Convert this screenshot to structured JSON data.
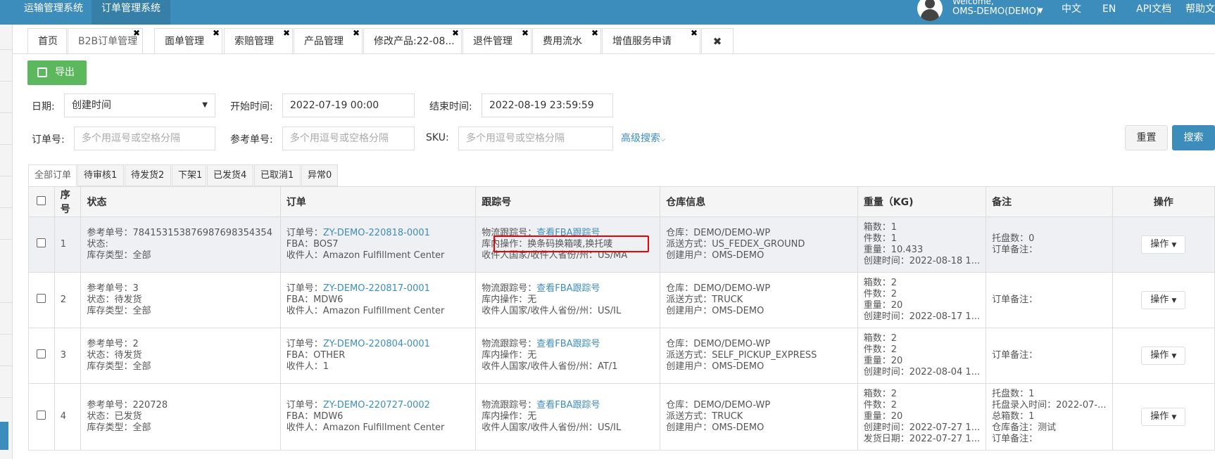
{
  "topbar": {
    "systems": [
      "运输管理系统",
      "订单管理系统"
    ],
    "welcome": "Welcome,",
    "user": "OMS-DEMO(DEMO)",
    "right_links": [
      "中文",
      "EN",
      "API文档",
      "帮助文"
    ]
  },
  "tabs": [
    {
      "label": "首页",
      "closable": false
    },
    {
      "label": "B2B订单管理",
      "closable": true,
      "active": true
    },
    {
      "label": "面单管理",
      "closable": true
    },
    {
      "label": "索赔管理",
      "closable": true
    },
    {
      "label": "产品管理",
      "closable": true
    },
    {
      "label": "修改产品:22-08...",
      "closable": true
    },
    {
      "label": "退件管理",
      "closable": true
    },
    {
      "label": "费用流水",
      "closable": true
    },
    {
      "label": "增值服务申请",
      "closable": true
    }
  ],
  "toolbar": {
    "export_label": "导出"
  },
  "filters": {
    "date_label": "日期:",
    "date_type": "创建时间",
    "start_label": "开始时间:",
    "start_value": "2022-07-19 00:00",
    "end_label": "结束时间:",
    "end_value": "2022-08-19 23:59:59",
    "order_label": "订单号:",
    "order_placeholder": "多个用逗号或空格分隔",
    "ref_label": "参考单号:",
    "ref_placeholder": "多个用逗号或空格分隔",
    "sku_label": "SKU:",
    "sku_placeholder": "多个用逗号或空格分隔",
    "advanced": "高级搜索",
    "reset": "重置",
    "search": "搜索"
  },
  "status_tabs": [
    "全部订单",
    "待审核1",
    "待发货2",
    "下架1",
    "已发货4",
    "已取消1",
    "异常0"
  ],
  "table": {
    "headers": [
      "序号",
      "状态",
      "订单",
      "跟踪号",
      "仓库信息",
      "重量（KG)",
      "备注",
      "操作"
    ],
    "rows": [
      {
        "no": "1",
        "status": [
          "参考单号：784153153876987698354354",
          "状态:",
          "库存类型：全部"
        ],
        "order_label": "订单号：",
        "order_link": "ZY-DEMO-220818-0001",
        "order_lines": [
          "FBA：BOS7",
          "收件人：Amazon Fulfillment Center"
        ],
        "track_label": "物流跟踪号：",
        "track_link": "查看FBA跟踪号",
        "track_lines": [
          "库内操作：换条码换箱唛,换托唛",
          "收件人国家/收件人省份/州：US/MA"
        ],
        "warehouse": [
          "仓库：DEMO/DEMO-WP",
          "派送方式：US_FEDEX_GROUND",
          "创建用户：OMS-DEMO"
        ],
        "weight": [
          "箱数：1",
          "件数：1",
          "重量：10.433",
          "创建时间：2022-08-18 1..."
        ],
        "remark": [
          "托盘数：0",
          "订单备注："
        ],
        "op": "操作"
      },
      {
        "no": "2",
        "status": [
          "参考单号：3",
          "状态：待发货",
          "库存类型：全部"
        ],
        "order_label": "订单号：",
        "order_link": "ZY-DEMO-220817-0001",
        "order_lines": [
          "FBA：MDW6",
          "收件人：Amazon Fulfillment Center"
        ],
        "track_label": "物流跟踪号：",
        "track_link": "查看FBA跟踪号",
        "track_lines": [
          "库内操作：无",
          "收件人国家/收件人省份/州：US/IL"
        ],
        "warehouse": [
          "仓库：DEMO/DEMO-WP",
          "派送方式：TRUCK",
          "创建用户：OMS-DEMO"
        ],
        "weight": [
          "箱数：2",
          "件数：2",
          "重量：20",
          "创建时间：2022-08-17 1..."
        ],
        "remark": [
          "订单备注："
        ],
        "op": "操作"
      },
      {
        "no": "3",
        "status": [
          "参考单号：2",
          "状态：待发货",
          "库存类型：全部"
        ],
        "order_label": "订单号：",
        "order_link": "ZY-DEMO-220804-0001",
        "order_lines": [
          "FBA：OTHER",
          "收件人：1"
        ],
        "track_label": "物流跟踪号：",
        "track_link": "查看FBA跟踪号",
        "track_lines": [
          "库内操作：无",
          "收件人国家/收件人省份/州：AT/1"
        ],
        "warehouse": [
          "仓库：DEMO/DEMO-WP",
          "派送方式：SELF_PICKUP_EXPRESS",
          "创建用户：OMS-DEMO"
        ],
        "weight": [
          "箱数：2",
          "件数：2",
          "重量：20",
          "创建时间：2022-08-04 1..."
        ],
        "remark": [
          "订单备注："
        ],
        "op": "操作"
      },
      {
        "no": "4",
        "status": [
          "参考单号：220728",
          "状态：已发货",
          "库存类型：全部"
        ],
        "order_label": "订单号：",
        "order_link": "ZY-DEMO-220727-0002",
        "order_lines": [
          "FBA：MDW6",
          "收件人：Amazon Fulfillment Center"
        ],
        "track_label": "物流跟踪号：",
        "track_link": "查看FBA跟踪号",
        "track_lines": [
          "库内操作：无",
          "收件人国家/收件人省份/州：US/IL"
        ],
        "warehouse": [
          "仓库：DEMO/DEMO-WP",
          "派送方式：TRUCK",
          "创建用户：OMS-DEMO"
        ],
        "weight": [
          "箱数：2",
          "件数：2",
          "重量：20",
          "创建时间：2022-07-27 1...",
          "发货日期：2022-07-27 1..."
        ],
        "remark": [
          "托盘数：1",
          "托盘录入时间：2022-07-...",
          "总箱数：1",
          "仓库备注：测试",
          "订单备注："
        ],
        "op": "操作"
      }
    ]
  },
  "colors": {
    "topbar": "#3c8dbc",
    "export": "#5cb85c",
    "link": "#3c8dbc",
    "highlight_box": "#e00000"
  }
}
